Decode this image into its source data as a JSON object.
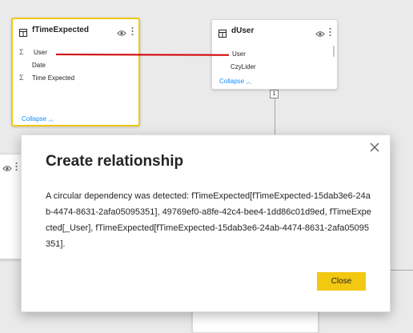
{
  "tables": {
    "fTimeExpected": {
      "title": "fTimeExpected",
      "fields": [
        {
          "name": "User",
          "aggregate": true
        },
        {
          "name": "Date",
          "aggregate": false
        },
        {
          "name": "Time Expected",
          "aggregate": true
        }
      ],
      "collapse_label": "Collapse"
    },
    "dUser": {
      "title": "dUser",
      "fields": [
        {
          "name": "User",
          "aggregate": false
        },
        {
          "name": "CzyLider",
          "aggregate": false
        }
      ],
      "collapse_label": "Collapse"
    }
  },
  "relationship": {
    "cardinality_label": "1"
  },
  "dialog": {
    "title": "Create relationship",
    "message": "A circular dependency was detected: fTimeExpected[fTimeExpected-15dab3e6-24ab-4474-8631-2afa05095351], 49769ef0-a8fe-42c4-bee4-1dd86c01d9ed, fTimeExpected[_User], fTimeExpected[fTimeExpected-15dab3e6-24ab-4474-8631-2afa05095351].",
    "close_label": "Close"
  },
  "colors": {
    "accent": "#f2c811",
    "link": "#118dff",
    "drag_line": "#d00000",
    "canvas": "#eaeaea"
  },
  "icons": {
    "table": "table-icon",
    "visibility": "eye-icon",
    "more": "more-options-icon",
    "aggregate": "sigma-icon",
    "close": "close-icon",
    "collapse": "chevron-up-icon"
  }
}
